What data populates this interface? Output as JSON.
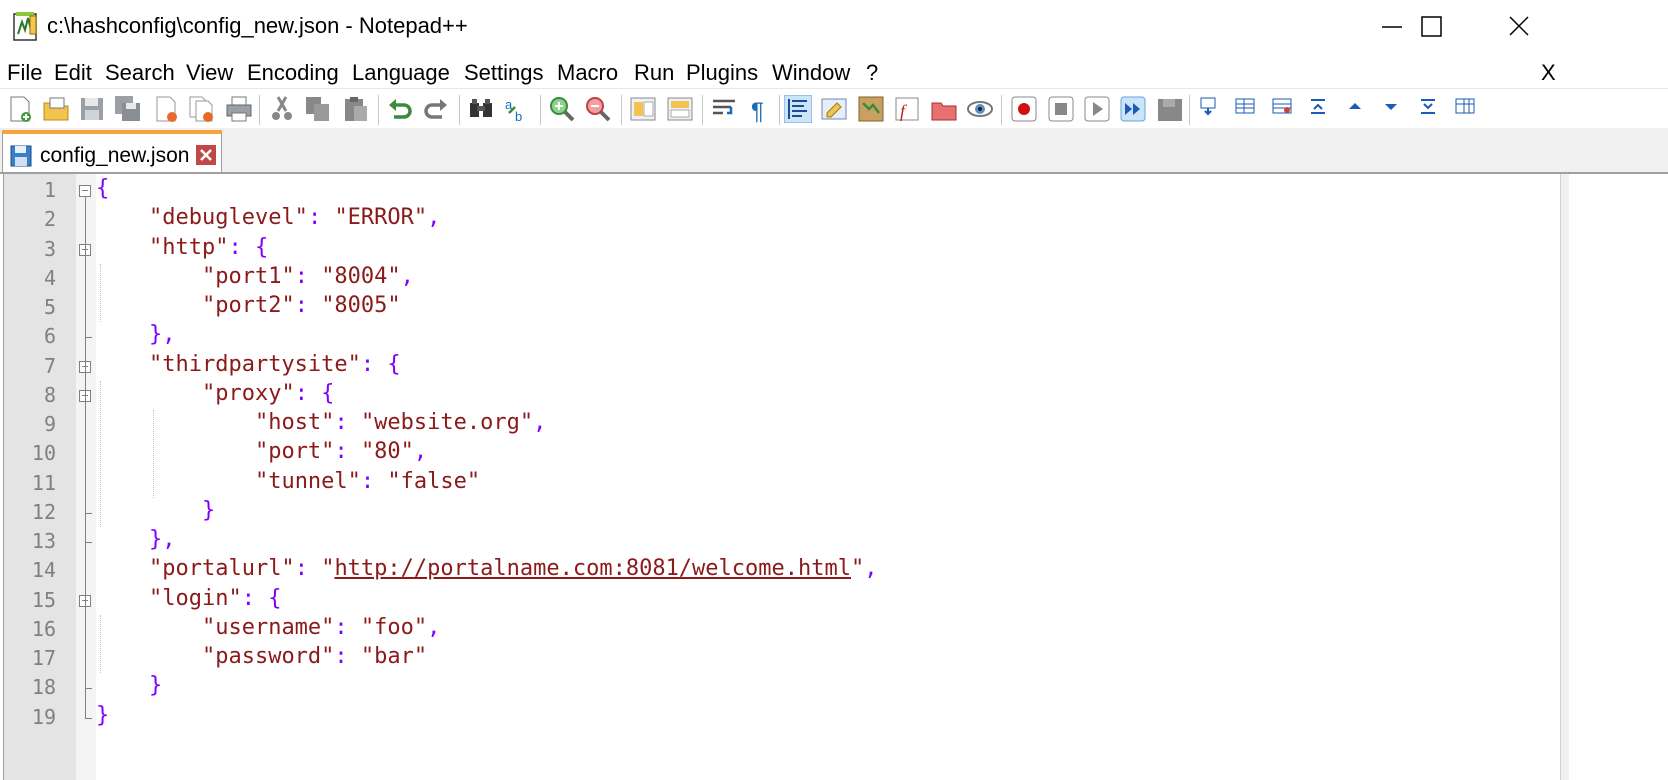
{
  "window": {
    "title": "c:\\hashconfig\\config_new.json - Notepad++",
    "controls": [
      "minimize",
      "maximize",
      "close"
    ]
  },
  "menu": {
    "items": [
      "File",
      "Edit",
      "Search",
      "View",
      "Encoding",
      "Language",
      "Settings",
      "Macro",
      "Run",
      "Plugins",
      "Window",
      "?"
    ],
    "close_label": "X"
  },
  "toolbar": {
    "icons": [
      "new-file-icon",
      "open-file-icon",
      "save-icon",
      "save-all-icon",
      "close-icon",
      "close-all-icon",
      "print-icon",
      "cut-icon",
      "copy-icon",
      "paste-icon",
      "undo-icon",
      "redo-icon",
      "find-icon",
      "replace-icon",
      "zoom-in-icon",
      "zoom-out-icon",
      "sync-vertical-icon",
      "sync-horizontal-icon",
      "word-wrap-icon",
      "show-all-chars-icon",
      "indent-guide-icon",
      "language-udl-icon",
      "document-map-icon",
      "function-list-icon",
      "folder-workspace-icon",
      "monitoring-icon",
      "record-macro-icon",
      "stop-macro-icon",
      "play-macro-icon",
      "run-macro-multiple-icon",
      "save-macro-icon",
      "plugin-1-icon",
      "plugin-2-icon",
      "plugin-3-icon",
      "plugin-4-icon",
      "plugin-5-icon",
      "plugin-6-icon",
      "plugin-7-icon",
      "plugin-8-icon"
    ]
  },
  "tab": {
    "label": "config_new.json",
    "active_color": "#f9a33b"
  },
  "colors": {
    "string": "#8b1a1a",
    "operator": "#8000ff",
    "line_number": "#808080",
    "gutter": "#e4e4e4"
  },
  "editor": {
    "lines": [
      [
        {
          "t": "o",
          "v": "{"
        }
      ],
      [
        {
          "t": "x",
          "v": "    "
        },
        {
          "t": "s",
          "v": "\"debuglevel\""
        },
        {
          "t": "o",
          "v": ": "
        },
        {
          "t": "s",
          "v": "\"ERROR\""
        },
        {
          "t": "o",
          "v": ","
        }
      ],
      [
        {
          "t": "x",
          "v": "    "
        },
        {
          "t": "s",
          "v": "\"http\""
        },
        {
          "t": "o",
          "v": ": {"
        }
      ],
      [
        {
          "t": "x",
          "v": "        "
        },
        {
          "t": "s",
          "v": "\"port1\""
        },
        {
          "t": "o",
          "v": ": "
        },
        {
          "t": "s",
          "v": "\"8004\""
        },
        {
          "t": "o",
          "v": ","
        }
      ],
      [
        {
          "t": "x",
          "v": "        "
        },
        {
          "t": "s",
          "v": "\"port2\""
        },
        {
          "t": "o",
          "v": ": "
        },
        {
          "t": "s",
          "v": "\"8005\""
        }
      ],
      [
        {
          "t": "x",
          "v": "    "
        },
        {
          "t": "o",
          "v": "},"
        }
      ],
      [
        {
          "t": "x",
          "v": "    "
        },
        {
          "t": "s",
          "v": "\"thirdpartysite\""
        },
        {
          "t": "o",
          "v": ": {"
        }
      ],
      [
        {
          "t": "x",
          "v": "        "
        },
        {
          "t": "s",
          "v": "\"proxy\""
        },
        {
          "t": "o",
          "v": ": {"
        }
      ],
      [
        {
          "t": "x",
          "v": "            "
        },
        {
          "t": "s",
          "v": "\"host\""
        },
        {
          "t": "o",
          "v": ": "
        },
        {
          "t": "s",
          "v": "\"website.org\""
        },
        {
          "t": "o",
          "v": ","
        }
      ],
      [
        {
          "t": "x",
          "v": "            "
        },
        {
          "t": "s",
          "v": "\"port\""
        },
        {
          "t": "o",
          "v": ": "
        },
        {
          "t": "s",
          "v": "\"80\""
        },
        {
          "t": "o",
          "v": ","
        }
      ],
      [
        {
          "t": "x",
          "v": "            "
        },
        {
          "t": "s",
          "v": "\"tunnel\""
        },
        {
          "t": "o",
          "v": ": "
        },
        {
          "t": "s",
          "v": "\"false\""
        }
      ],
      [
        {
          "t": "x",
          "v": "        "
        },
        {
          "t": "o",
          "v": "}"
        }
      ],
      [
        {
          "t": "x",
          "v": "    "
        },
        {
          "t": "o",
          "v": "},"
        }
      ],
      [
        {
          "t": "x",
          "v": "    "
        },
        {
          "t": "s",
          "v": "\"portalurl\""
        },
        {
          "t": "o",
          "v": ": "
        },
        {
          "t": "s",
          "v": "\""
        },
        {
          "t": "u",
          "v": "http://portalname.com:8081/welcome.html"
        },
        {
          "t": "s",
          "v": "\""
        },
        {
          "t": "o",
          "v": ","
        }
      ],
      [
        {
          "t": "x",
          "v": "    "
        },
        {
          "t": "s",
          "v": "\"login\""
        },
        {
          "t": "o",
          "v": ": {"
        }
      ],
      [
        {
          "t": "x",
          "v": "        "
        },
        {
          "t": "s",
          "v": "\"username\""
        },
        {
          "t": "o",
          "v": ": "
        },
        {
          "t": "s",
          "v": "\"foo\""
        },
        {
          "t": "o",
          "v": ","
        }
      ],
      [
        {
          "t": "x",
          "v": "        "
        },
        {
          "t": "s",
          "v": "\"password\""
        },
        {
          "t": "o",
          "v": ": "
        },
        {
          "t": "s",
          "v": "\"bar\""
        }
      ],
      [
        {
          "t": "x",
          "v": "    "
        },
        {
          "t": "o",
          "v": "}"
        }
      ],
      [
        {
          "t": "o",
          "v": "}"
        }
      ]
    ],
    "line_numbers": [
      "1",
      "2",
      "3",
      "4",
      "5",
      "6",
      "7",
      "8",
      "9",
      "10",
      "11",
      "12",
      "13",
      "14",
      "15",
      "16",
      "17",
      "18",
      "19"
    ],
    "fold_markers": [
      "open",
      null,
      "open",
      null,
      null,
      "end",
      "open",
      "open",
      null,
      null,
      null,
      "end",
      "end",
      null,
      "open",
      null,
      null,
      "end",
      "end"
    ]
  }
}
